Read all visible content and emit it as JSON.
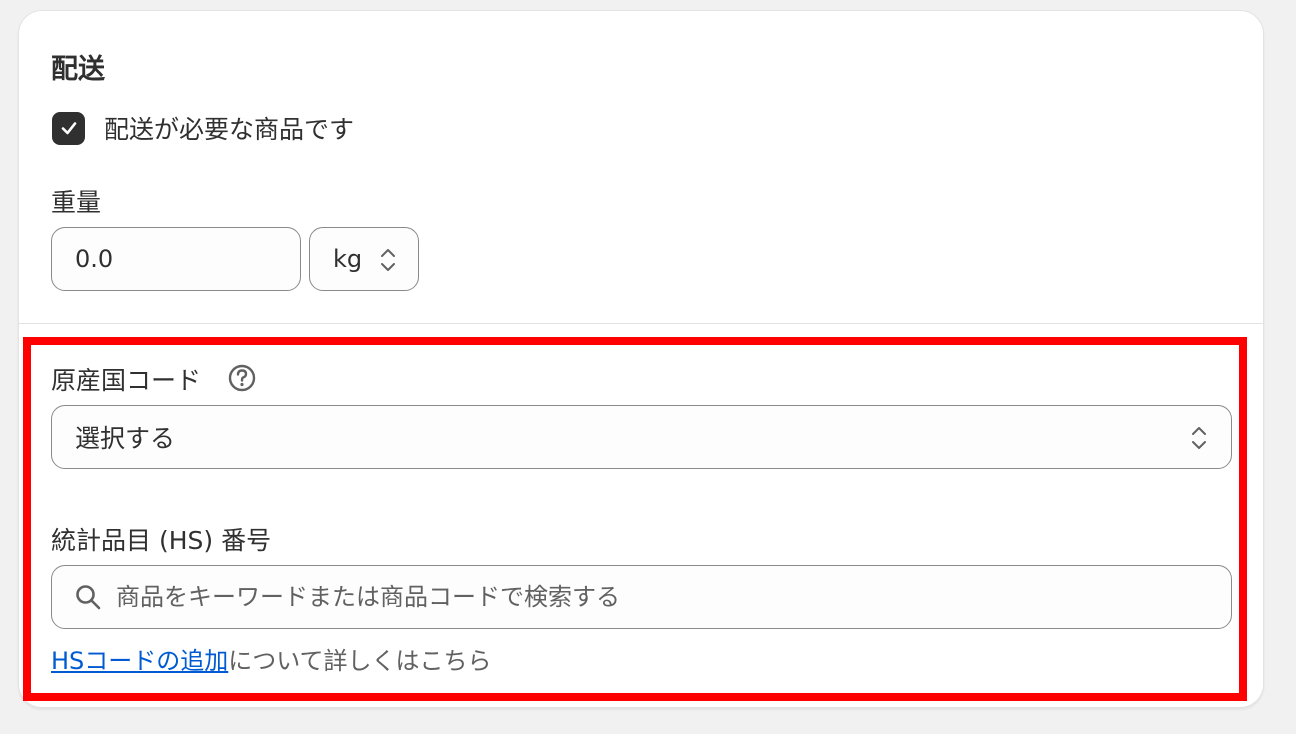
{
  "shipping": {
    "title": "配送",
    "requires_shipping_label": "配送が必要な商品です",
    "requires_shipping_checked": true,
    "weight_label": "重量",
    "weight_value": "0.0",
    "weight_unit": "kg"
  },
  "customs": {
    "country_label": "原産国コード",
    "country_select_value": "選択する",
    "hs_label": "統計品目 (HS) 番号",
    "hs_placeholder": "商品をキーワードまたは商品コードで検索する",
    "help_link_text": "HSコードの追加",
    "help_suffix": "について詳しくはこちら"
  },
  "colors": {
    "highlight": "#ff0000",
    "link": "#005bd3",
    "checkbox": "#303030"
  },
  "icons": [
    "checkmark-icon",
    "chevron-up-down-icon",
    "question-circle-icon",
    "search-icon"
  ]
}
